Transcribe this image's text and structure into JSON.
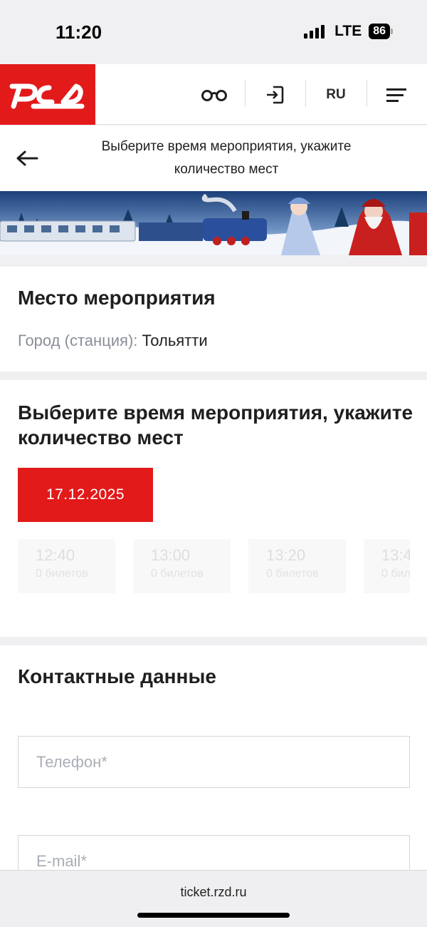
{
  "status_bar": {
    "time": "11:20",
    "network": "LTE",
    "battery": "86"
  },
  "header": {
    "logo_icon": "rzd-logo",
    "accessibility_icon": "glasses-icon",
    "login_icon": "login-icon",
    "language": "RU",
    "menu_icon": "hamburger-menu-icon",
    "accent_color": "#e21a1a"
  },
  "title_bar": {
    "back_icon": "arrow-left-icon",
    "title": "Выберите время мероприятия, укажите количество мест"
  },
  "venue": {
    "heading": "Место мероприятия",
    "city_label": "Город (станция):",
    "city_value": "Тольятти"
  },
  "schedule": {
    "heading": "Выберите время мероприятия, укажите количество мест",
    "selected_date": "17.12.2025",
    "slots": [
      {
        "time": "12:40",
        "tickets": "0 билетов"
      },
      {
        "time": "13:00",
        "tickets": "0 билетов"
      },
      {
        "time": "13:20",
        "tickets": "0 билетов"
      },
      {
        "time": "13:4",
        "tickets": "0 бил"
      }
    ]
  },
  "contact": {
    "heading": "Контактные данные",
    "phone_placeholder": "Телефон*",
    "email_placeholder": "E-mail*"
  },
  "browser": {
    "url": "ticket.rzd.ru"
  }
}
